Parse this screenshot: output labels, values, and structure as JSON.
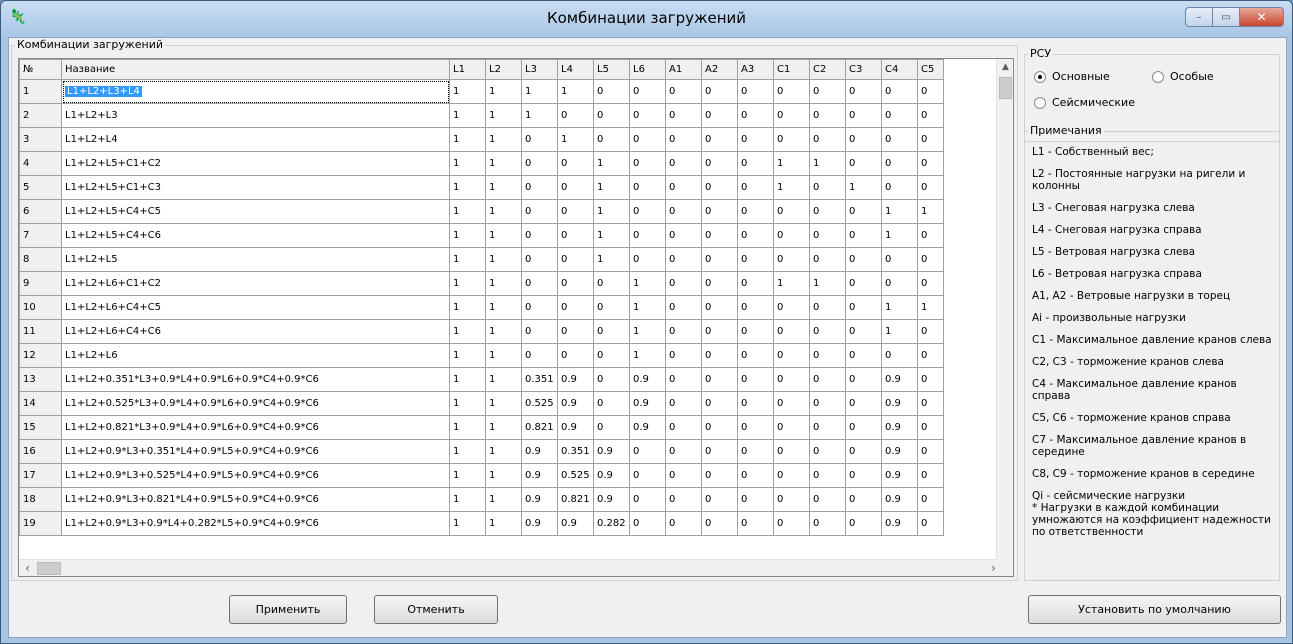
{
  "window": {
    "title": "Комбинации загружений",
    "app_icon": "🦎",
    "controls": {
      "minimize": "–",
      "maximize": "▭",
      "close": "✕"
    }
  },
  "grid_group": {
    "legend": "Комбинации загружений",
    "headers": [
      "№",
      "Название",
      "L1",
      "L2",
      "L3",
      "L4",
      "L5",
      "L6",
      "A1",
      "A2",
      "A3",
      "C1",
      "C2",
      "C3",
      "C4",
      "C5"
    ],
    "rows": [
      [
        "1",
        "L1+L2+L3+L4",
        "1",
        "1",
        "1",
        "1",
        "0",
        "0",
        "0",
        "0",
        "0",
        "0",
        "0",
        "0",
        "0",
        "0"
      ],
      [
        "2",
        "L1+L2+L3",
        "1",
        "1",
        "1",
        "0",
        "0",
        "0",
        "0",
        "0",
        "0",
        "0",
        "0",
        "0",
        "0",
        "0"
      ],
      [
        "3",
        "L1+L2+L4",
        "1",
        "1",
        "0",
        "1",
        "0",
        "0",
        "0",
        "0",
        "0",
        "0",
        "0",
        "0",
        "0",
        "0"
      ],
      [
        "4",
        "L1+L2+L5+C1+C2",
        "1",
        "1",
        "0",
        "0",
        "1",
        "0",
        "0",
        "0",
        "0",
        "1",
        "1",
        "0",
        "0",
        "0"
      ],
      [
        "5",
        "L1+L2+L5+C1+C3",
        "1",
        "1",
        "0",
        "0",
        "1",
        "0",
        "0",
        "0",
        "0",
        "1",
        "0",
        "1",
        "0",
        "0"
      ],
      [
        "6",
        "L1+L2+L5+C4+C5",
        "1",
        "1",
        "0",
        "0",
        "1",
        "0",
        "0",
        "0",
        "0",
        "0",
        "0",
        "0",
        "1",
        "1"
      ],
      [
        "7",
        "L1+L2+L5+C4+C6",
        "1",
        "1",
        "0",
        "0",
        "1",
        "0",
        "0",
        "0",
        "0",
        "0",
        "0",
        "0",
        "1",
        "0"
      ],
      [
        "8",
        "L1+L2+L5",
        "1",
        "1",
        "0",
        "0",
        "1",
        "0",
        "0",
        "0",
        "0",
        "0",
        "0",
        "0",
        "0",
        "0"
      ],
      [
        "9",
        "L1+L2+L6+C1+C2",
        "1",
        "1",
        "0",
        "0",
        "0",
        "1",
        "0",
        "0",
        "0",
        "1",
        "1",
        "0",
        "0",
        "0"
      ],
      [
        "10",
        "L1+L2+L6+C4+C5",
        "1",
        "1",
        "0",
        "0",
        "0",
        "1",
        "0",
        "0",
        "0",
        "0",
        "0",
        "0",
        "1",
        "1"
      ],
      [
        "11",
        "L1+L2+L6+C4+C6",
        "1",
        "1",
        "0",
        "0",
        "0",
        "1",
        "0",
        "0",
        "0",
        "0",
        "0",
        "0",
        "1",
        "0"
      ],
      [
        "12",
        "L1+L2+L6",
        "1",
        "1",
        "0",
        "0",
        "0",
        "1",
        "0",
        "0",
        "0",
        "0",
        "0",
        "0",
        "0",
        "0"
      ],
      [
        "13",
        "L1+L2+0.351*L3+0.9*L4+0.9*L6+0.9*C4+0.9*C6",
        "1",
        "1",
        "0.351",
        "0.9",
        "0",
        "0.9",
        "0",
        "0",
        "0",
        "0",
        "0",
        "0",
        "0.9",
        "0"
      ],
      [
        "14",
        "L1+L2+0.525*L3+0.9*L4+0.9*L6+0.9*C4+0.9*C6",
        "1",
        "1",
        "0.525",
        "0.9",
        "0",
        "0.9",
        "0",
        "0",
        "0",
        "0",
        "0",
        "0",
        "0.9",
        "0"
      ],
      [
        "15",
        "L1+L2+0.821*L3+0.9*L4+0.9*L6+0.9*C4+0.9*C6",
        "1",
        "1",
        "0.821",
        "0.9",
        "0",
        "0.9",
        "0",
        "0",
        "0",
        "0",
        "0",
        "0",
        "0.9",
        "0"
      ],
      [
        "16",
        "L1+L2+0.9*L3+0.351*L4+0.9*L5+0.9*C4+0.9*C6",
        "1",
        "1",
        "0.9",
        "0.351",
        "0.9",
        "0",
        "0",
        "0",
        "0",
        "0",
        "0",
        "0",
        "0.9",
        "0"
      ],
      [
        "17",
        "L1+L2+0.9*L3+0.525*L4+0.9*L5+0.9*C4+0.9*C6",
        "1",
        "1",
        "0.9",
        "0.525",
        "0.9",
        "0",
        "0",
        "0",
        "0",
        "0",
        "0",
        "0",
        "0.9",
        "0"
      ],
      [
        "18",
        "L1+L2+0.9*L3+0.821*L4+0.9*L5+0.9*C4+0.9*C6",
        "1",
        "1",
        "0.9",
        "0.821",
        "0.9",
        "0",
        "0",
        "0",
        "0",
        "0",
        "0",
        "0",
        "0.9",
        "0"
      ]
    ],
    "partial_row": [
      "19",
      "L1+L2+0.9*L3+0.9*L4+0.282*L5+0.9*C4+0.9*C6",
      "1",
      "1",
      "0.9",
      "0.9",
      "0.282",
      "0",
      "0",
      "0",
      "0",
      "0",
      "0",
      "0",
      "0.9",
      "0"
    ]
  },
  "rsu_group": {
    "legend": "РСУ",
    "options": [
      "Основные",
      "Особые",
      "Сейсмические"
    ],
    "selected": "Основные"
  },
  "notes_group": {
    "legend": "Примечания",
    "items": [
      "L1 - Собственный вес;",
      "L2 - Постоянные нагрузки на ригели и колонны",
      "L3 - Снеговая нагрузка слева",
      "L4 - Снеговая нагрузка справа",
      "L5 - Ветровая нагрузка слева",
      "L6 - Ветровая нагрузка справа",
      "A1, A2 - Ветровые нагрузки в торец",
      "Ai - произвольные нагрузки",
      "C1 - Максимальное давление  кранов слева",
      "C2, C3 - торможение кранов слева",
      "C4 - Максимальное давление  кранов справа",
      "C5, C6 - торможение кранов справа",
      "C7 - Максимальное давление  кранов в середине",
      "C8, C9 - торможение кранов в середине",
      "Qi - сейсмические нагрузки"
    ],
    "footnote": "* Нагрузки в каждой комбинации умножаются на коэффициент надежности по ответственности"
  },
  "buttons": {
    "apply": "Применить",
    "cancel": "Отменить",
    "defaults": "Установить по умолчанию"
  }
}
